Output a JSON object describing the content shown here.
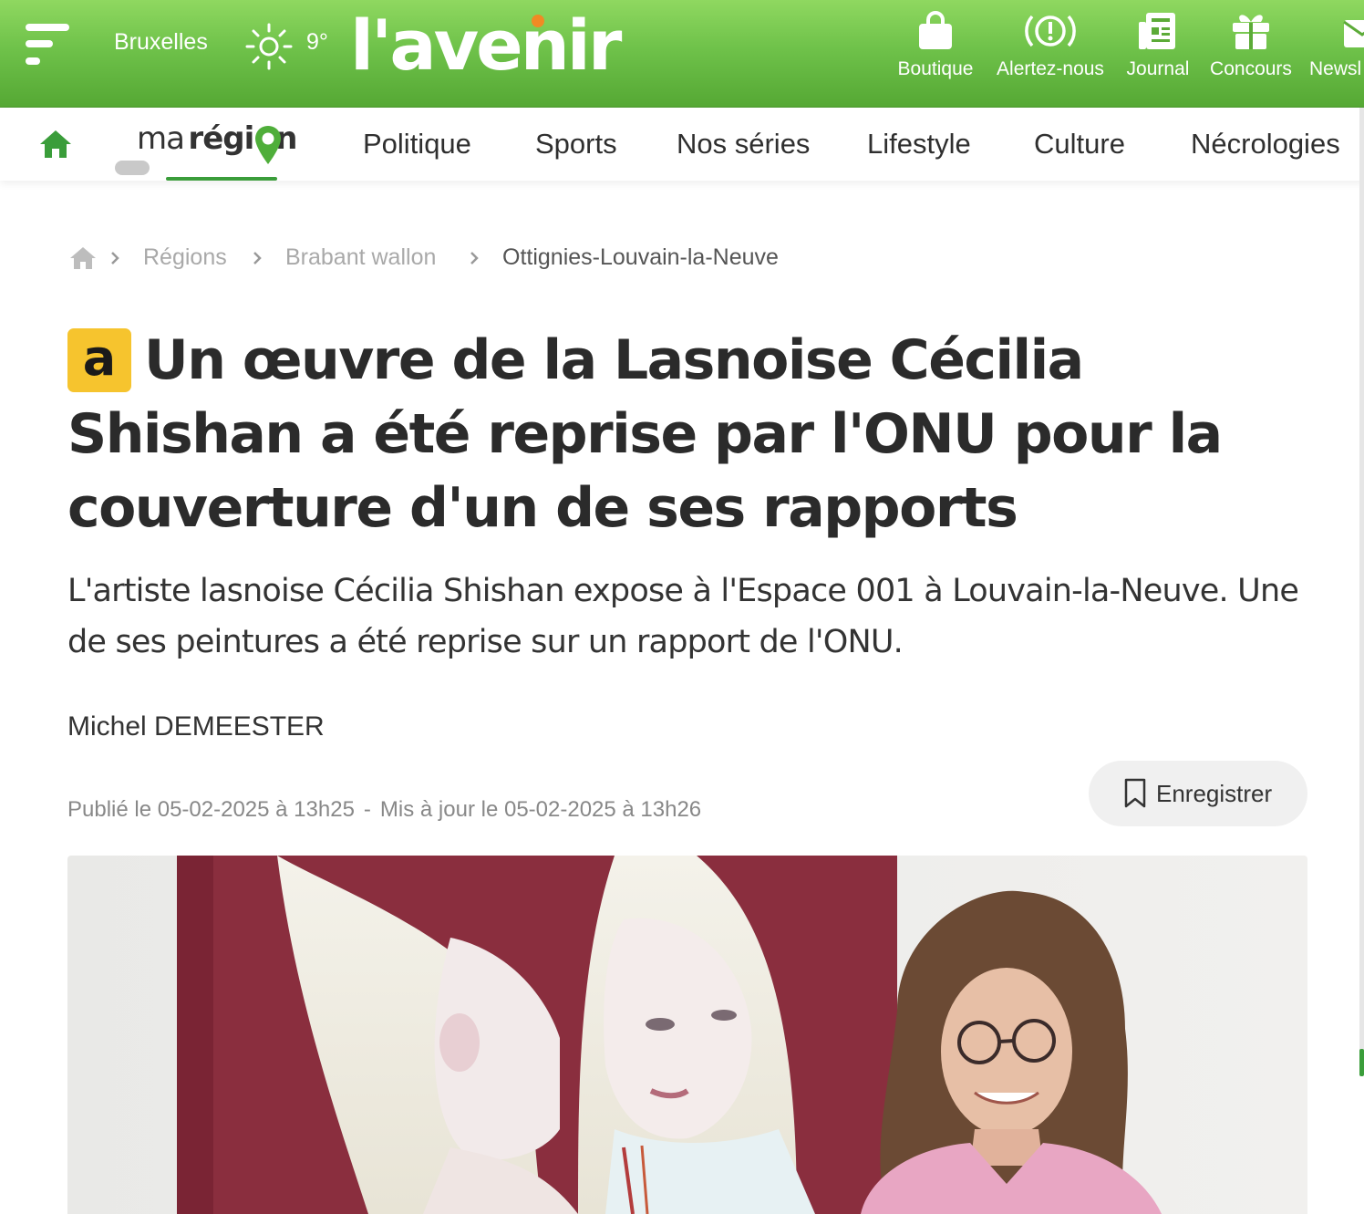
{
  "header": {
    "city": "Bruxelles",
    "temperature": "9°",
    "logo_text": "l'avenir",
    "nav": [
      {
        "label": "Boutique",
        "icon": "shopping-bag-icon"
      },
      {
        "label": "Alertez-nous",
        "icon": "alert-icon"
      },
      {
        "label": "Journal",
        "icon": "newspaper-icon"
      },
      {
        "label": "Concours",
        "icon": "gift-icon"
      },
      {
        "label": "Newsl",
        "icon": "mail-icon"
      }
    ]
  },
  "sections": {
    "home_icon": "home-icon",
    "ma": "ma",
    "region": "régi",
    "region_end": "n",
    "items": [
      "Politique",
      "Sports",
      "Nos séries",
      "Lifestyle",
      "Culture",
      "Nécrologies"
    ]
  },
  "breadcrumb": [
    "Régions",
    "Brabant wallon",
    "Ottignies-Louvain-la-Neuve"
  ],
  "article": {
    "badge": "a",
    "title": "Un œuvre de la Lasnoise Cécilia Shishan a été reprise par l'ONU pour la couverture d'un de ses rapports",
    "lede": "L'artiste lasnoise Cécilia Shishan expose à l'Espace 001 à Louvain-la-Neuve. Une de ses peintures a été reprise sur un rapport de l'ONU.",
    "author": "Michel DEMEESTER",
    "published": "Publié le 05-02-2025 à 13h25",
    "date_separator": "-",
    "updated": "Mis à jour le 05-02-2025 à 13h26",
    "save_label": "Enregistrer"
  },
  "colors": {
    "brand_green": "#6fc24a",
    "badge_yellow": "#f6c42e",
    "logo_dot": "#f08a24"
  }
}
